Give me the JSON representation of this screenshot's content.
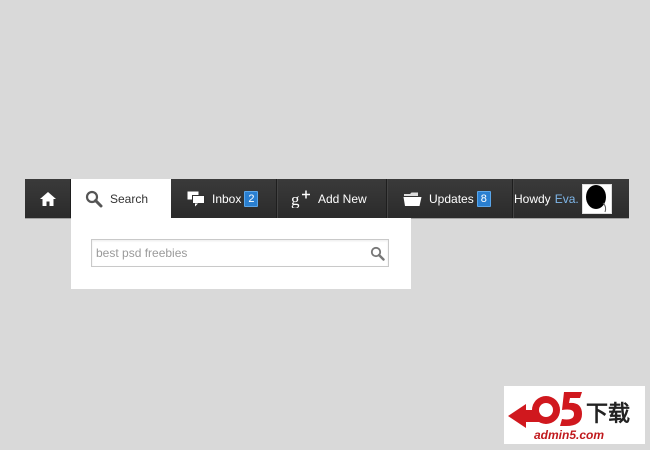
{
  "navbar": {
    "home_icon": "home-icon",
    "search_label": "Search",
    "inbox_label": "Inbox",
    "inbox_count": "2",
    "addnew_label": "Add New",
    "updates_label": "Updates",
    "updates_count": "8",
    "howdy_label": "Howdy",
    "user_name": "Eva."
  },
  "dropdown": {
    "search_value": "best psd freebies"
  },
  "watermark": {
    "brand_main": "a5下载",
    "brand_sub": "admin5.com"
  },
  "colors": {
    "navbar_bg": "#2f2f2f",
    "badge_bg": "#2a7fd0",
    "username": "#7fb7ea",
    "page_bg": "#d9d9d9"
  }
}
